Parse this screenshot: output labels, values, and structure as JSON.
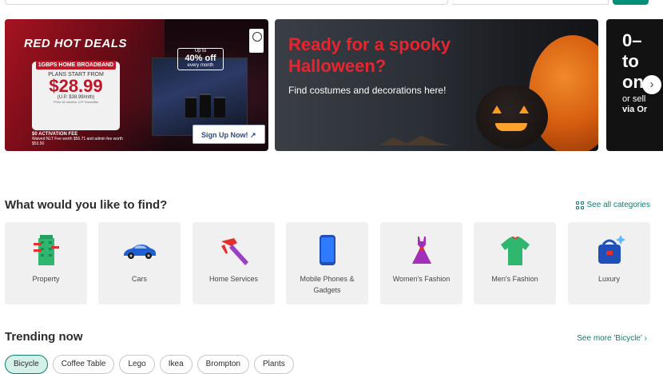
{
  "banners": {
    "deals": {
      "title": "RED HOT DEALS",
      "tag": "1GBPS HOME BROADBAND",
      "plans_line": "PLANS START FROM",
      "price": "$28.99",
      "usual": "(U.P. $38.99/mth)",
      "fine": "*First 18 months, U.P. thereafter",
      "activation": "$0 ACTIVATION FEE",
      "waived": "Waived NLT Fee worth $56.71 and admin fee worth $53.50",
      "promo_top": "Up to",
      "promo_big": "40% off",
      "promo_bottom": "every month",
      "cta": "Sign Up Now! ↗"
    },
    "halloween": {
      "headline": "Ready for a spooky Halloween?",
      "sub": "Find costumes and decorations here!"
    },
    "third": {
      "lines": [
        "0–",
        "to",
        "on"
      ],
      "small": [
        "or sell",
        "via Or"
      ]
    },
    "next_arrow": "›"
  },
  "categories": {
    "title": "What would you like to find?",
    "see_all": "See all categories",
    "items": [
      {
        "label": "Property",
        "icon": "building-icon"
      },
      {
        "label": "Cars",
        "icon": "car-icon"
      },
      {
        "label": "Home Services",
        "icon": "hammer-icon"
      },
      {
        "label": "Mobile Phones & Gadgets",
        "icon": "phone-icon"
      },
      {
        "label": "Women's Fashion",
        "icon": "dress-icon"
      },
      {
        "label": "Men's Fashion",
        "icon": "shirt-icon"
      },
      {
        "label": "Luxury",
        "icon": "handbag-icon"
      }
    ]
  },
  "trending": {
    "title": "Trending now",
    "see_more": "See more 'Bicycle' ›",
    "chips": [
      "Bicycle",
      "Coffee Table",
      "Lego",
      "Ikea",
      "Brompton",
      "Plants"
    ]
  },
  "colors": {
    "accent": "#0d7f6e",
    "brand_button": "#008f79",
    "halloween_red": "#e8242f",
    "deals_red": "#c21525"
  }
}
